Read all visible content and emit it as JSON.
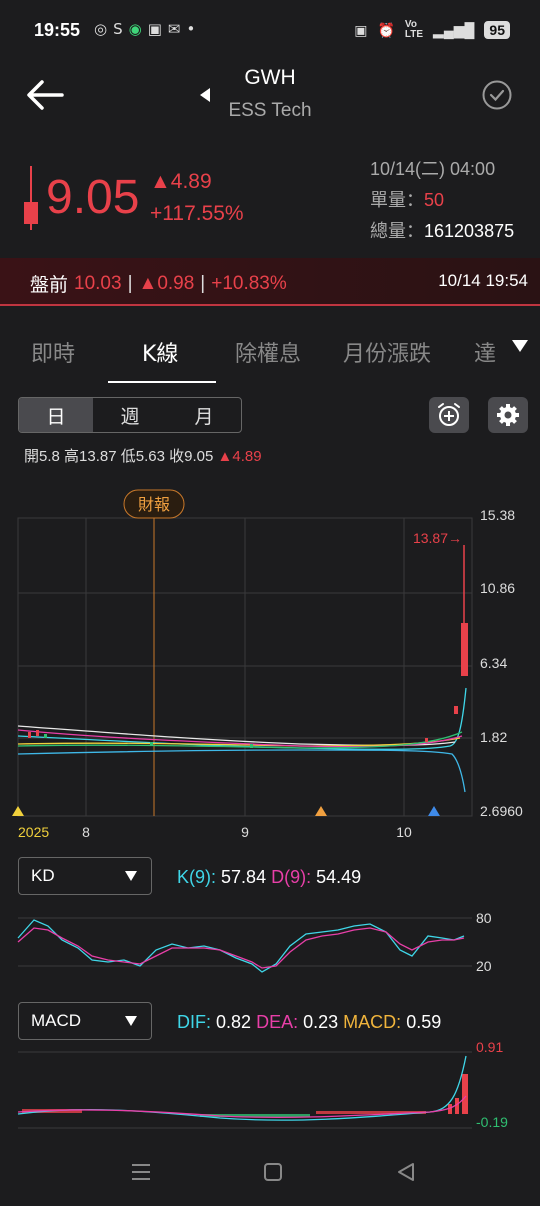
{
  "status": {
    "time": "19:55",
    "battery": "95"
  },
  "header": {
    "ticker": "GWH",
    "company": "ESS Tech"
  },
  "quote": {
    "price": "9.05",
    "change": "4.89",
    "change_pct": "+117.55%",
    "datetime": "10/14(二) 04:00",
    "unit_vol_label": "單量：",
    "unit_vol": "50",
    "total_vol_label": "總量：",
    "total_vol": "161203875"
  },
  "premarket": {
    "label": "盤前",
    "price": "10.03",
    "change": "0.98",
    "change_pct": "+10.83%",
    "sep": "|",
    "time": "10/14 19:54"
  },
  "tabs": [
    {
      "label": "即時"
    },
    {
      "label": "K線"
    },
    {
      "label": "除權息"
    },
    {
      "label": "月份漲跌"
    },
    {
      "label": "達"
    }
  ],
  "period": [
    {
      "label": "日"
    },
    {
      "label": "週"
    },
    {
      "label": "月"
    }
  ],
  "ohlc": {
    "open": "開5.8",
    "high": "高13.87",
    "low": "低5.63",
    "close": "收9.05",
    "change": "4.89"
  },
  "chart": {
    "event_label": "財報",
    "high_marker": "13.87→",
    "y_ticks": [
      "15.38",
      "10.86",
      "6.34",
      "1.82",
      "2.6960"
    ],
    "x_ticks": [
      "2025",
      "8",
      "9",
      "10"
    ]
  },
  "kd": {
    "selector": "KD",
    "k_label": "K(9):",
    "k_value": "57.84",
    "d_label": "D(9):",
    "d_value": "54.49",
    "y_ticks": [
      "80",
      "20"
    ]
  },
  "macd": {
    "selector": "MACD",
    "dif_label": "DIF:",
    "dif_value": "0.82",
    "dea_label": "DEA:",
    "dea_value": "0.23",
    "macd_label": "MACD:",
    "macd_value": "0.59",
    "y_top": "0.91",
    "y_bottom": "-0.19"
  },
  "colors": {
    "up": "#e8414a",
    "down": "#2fbf71",
    "k_line": "#3fd6e8",
    "d_line": "#e83fa8",
    "macd_label": "#f0b43c"
  }
}
